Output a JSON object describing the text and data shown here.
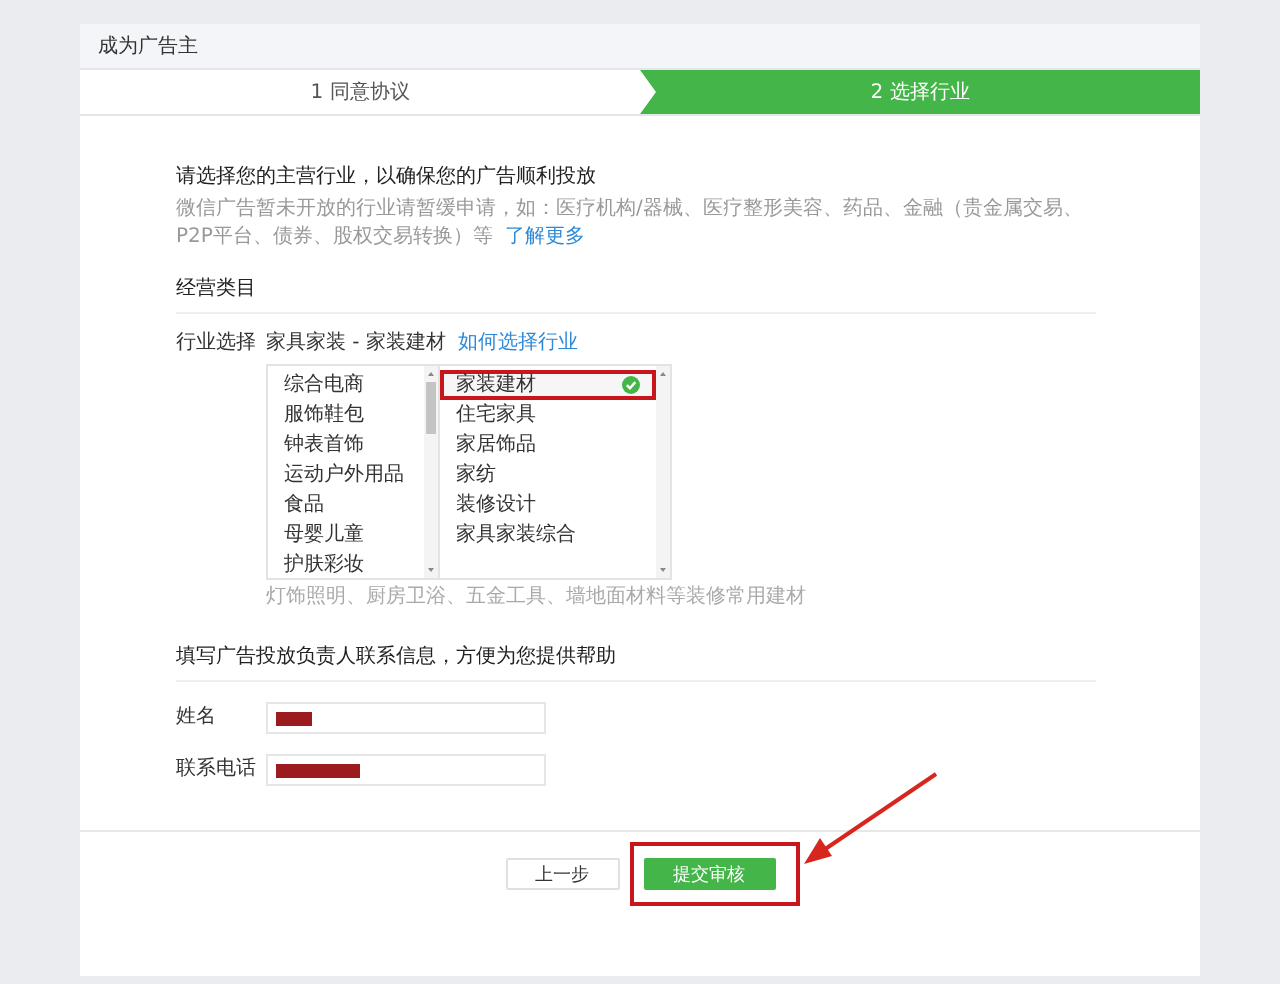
{
  "page": {
    "title": "成为广告主"
  },
  "steps": [
    {
      "label": "1 同意协议",
      "selected": false
    },
    {
      "label": "2 选择行业",
      "selected": true
    }
  ],
  "intro": {
    "heading": "请选择您的主营行业，以确保您的广告顺利投放",
    "note": "微信广告暂未开放的行业请暂缓申请，如：医疗机构/器械、医疗整形美容、药品、金融（贵金属交易、P2P平台、债券、股权交易转换）等",
    "link": "了解更多"
  },
  "category_section": {
    "title": "经营类目",
    "label": "行业选择",
    "current": "家具家装 - 家装建材",
    "help_link": "如何选择行业",
    "primary": [
      {
        "label": "综合电商"
      },
      {
        "label": "服饰鞋包"
      },
      {
        "label": "钟表首饰"
      },
      {
        "label": "运动户外用品"
      },
      {
        "label": "食品"
      },
      {
        "label": "母婴儿童"
      },
      {
        "label": "护肤彩妆"
      }
    ],
    "secondary": [
      {
        "label": "家装建材",
        "selected": true,
        "annotated": true
      },
      {
        "label": "住宅家具",
        "selected": false,
        "annotated": false
      },
      {
        "label": "家居饰品",
        "selected": false,
        "annotated": false
      },
      {
        "label": "家纺",
        "selected": false,
        "annotated": false
      },
      {
        "label": "装修设计",
        "selected": false,
        "annotated": false
      },
      {
        "label": "家具家装综合",
        "selected": false,
        "annotated": false
      }
    ],
    "hint": "灯饰照明、厨房卫浴、五金工具、墙地面材料等装修常用建材"
  },
  "contact_section": {
    "title": "填写广告投放负责人联系信息，方便为您提供帮助",
    "fields": [
      {
        "label": "姓名",
        "kind": "name",
        "redacted": true
      },
      {
        "label": "联系电话",
        "kind": "phone",
        "redacted": true
      }
    ]
  },
  "buttons": [
    {
      "label": "上一步",
      "kind": "secondary",
      "annotated": false
    },
    {
      "label": "提交审核",
      "kind": "primary",
      "annotated": true
    }
  ],
  "annotations": {
    "callout_arrow": true
  }
}
